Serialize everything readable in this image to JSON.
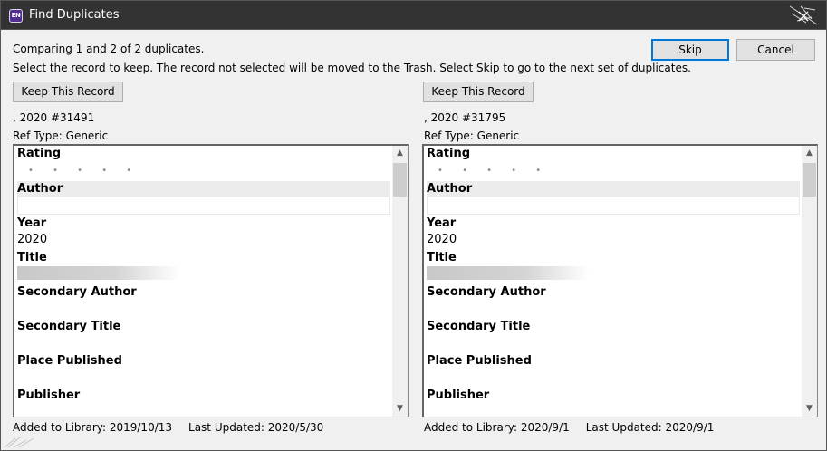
{
  "window": {
    "title": "Find Duplicates",
    "app_icon_text": "EN"
  },
  "header": {
    "comparing": "Comparing 1 and 2 of 2 duplicates.",
    "instructions": "Select the record to keep. The record not selected will be moved to the Trash. Select Skip to go to the next set of duplicates.",
    "skip_label": "Skip",
    "cancel_label": "Cancel"
  },
  "left": {
    "keep_label": "Keep This Record",
    "ref_id": ", 2020 #31491",
    "ref_type": "Ref Type: Generic",
    "fields": {
      "rating": "Rating",
      "rating_dots": "• • • • •",
      "author": "Author",
      "year": "Year",
      "year_value": "2020",
      "title": "Title",
      "secondary_author": "Secondary Author",
      "secondary_title": "Secondary Title",
      "place_published": "Place Published",
      "publisher": "Publisher"
    },
    "added": "Added to Library: 2019/10/13",
    "updated": "Last Updated: 2020/5/30"
  },
  "right": {
    "keep_label": "Keep This Record",
    "ref_id": ", 2020 #31795",
    "ref_type": "Ref Type: Generic",
    "fields": {
      "rating": "Rating",
      "rating_dots": "• • • • •",
      "author": "Author",
      "year": "Year",
      "year_value": "2020",
      "title": "Title",
      "secondary_author": "Secondary Author",
      "secondary_title": "Secondary Title",
      "place_published": "Place Published",
      "publisher": "Publisher"
    },
    "added": "Added to Library: 2020/9/1",
    "updated": "Last Updated: 2020/9/1"
  },
  "icons": {
    "app": "endnote-app-icon",
    "close": "close-icon",
    "scroll_up": "chevron-up-icon",
    "scroll_down": "chevron-down-icon"
  },
  "colors": {
    "titlebar": "#333333",
    "default_button_border": "#0078d7",
    "window_bg": "#f0f0f0"
  }
}
